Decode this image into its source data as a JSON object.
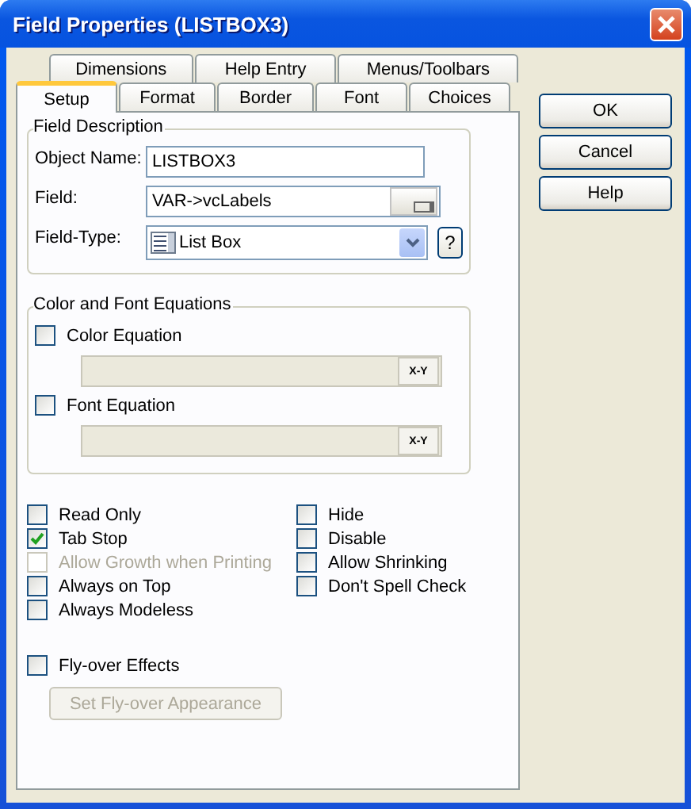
{
  "window": {
    "title": "Field Properties (LISTBOX3)"
  },
  "tabs": {
    "upper_row": [
      {
        "label": "Dimensions",
        "selected": false
      },
      {
        "label": "Help Entry",
        "selected": false
      },
      {
        "label": "Menus/Toolbars",
        "selected": false
      }
    ],
    "lower_row": [
      {
        "label": "Setup",
        "selected": true
      },
      {
        "label": "Format",
        "selected": false
      },
      {
        "label": "Border",
        "selected": false
      },
      {
        "label": "Font",
        "selected": false
      },
      {
        "label": "Choices",
        "selected": false
      }
    ]
  },
  "field_description": {
    "title": "Field Description",
    "object_name": {
      "label": "Object Name:",
      "value": "LISTBOX3"
    },
    "field": {
      "label": "Field:",
      "value": "VAR->vcLabels"
    },
    "field_type": {
      "label": "Field-Type:",
      "value": "List Box",
      "help_button": "?"
    }
  },
  "equations": {
    "title": "Color and Font Equations",
    "items": [
      {
        "label": "Color Equation",
        "checked": false,
        "button": "X-Y"
      },
      {
        "label": "Font Equation",
        "checked": false,
        "button": "X-Y"
      }
    ]
  },
  "options": {
    "left": [
      {
        "label": "Read Only",
        "checked": false,
        "disabled": false
      },
      {
        "label": "Tab Stop",
        "checked": true,
        "disabled": false
      },
      {
        "label": "Allow Growth when Printing",
        "checked": false,
        "disabled": true
      },
      {
        "label": "Always on Top",
        "checked": false,
        "disabled": false
      },
      {
        "label": "Always Modeless",
        "checked": false,
        "disabled": false
      }
    ],
    "right": [
      {
        "label": "Hide",
        "checked": false,
        "disabled": false
      },
      {
        "label": "Disable",
        "checked": false,
        "disabled": false
      },
      {
        "label": "Allow Shrinking",
        "checked": false,
        "disabled": false
      },
      {
        "label": "Don't Spell Check",
        "checked": false,
        "disabled": false
      }
    ]
  },
  "flyover": {
    "label": "Fly-over Effects",
    "checked": false,
    "disabled": false,
    "appearance_button": {
      "label": "Set Fly-over Appearance",
      "disabled": true
    }
  },
  "buttons": [
    {
      "label": "OK"
    },
    {
      "label": "Cancel"
    },
    {
      "label": "Help"
    }
  ]
}
